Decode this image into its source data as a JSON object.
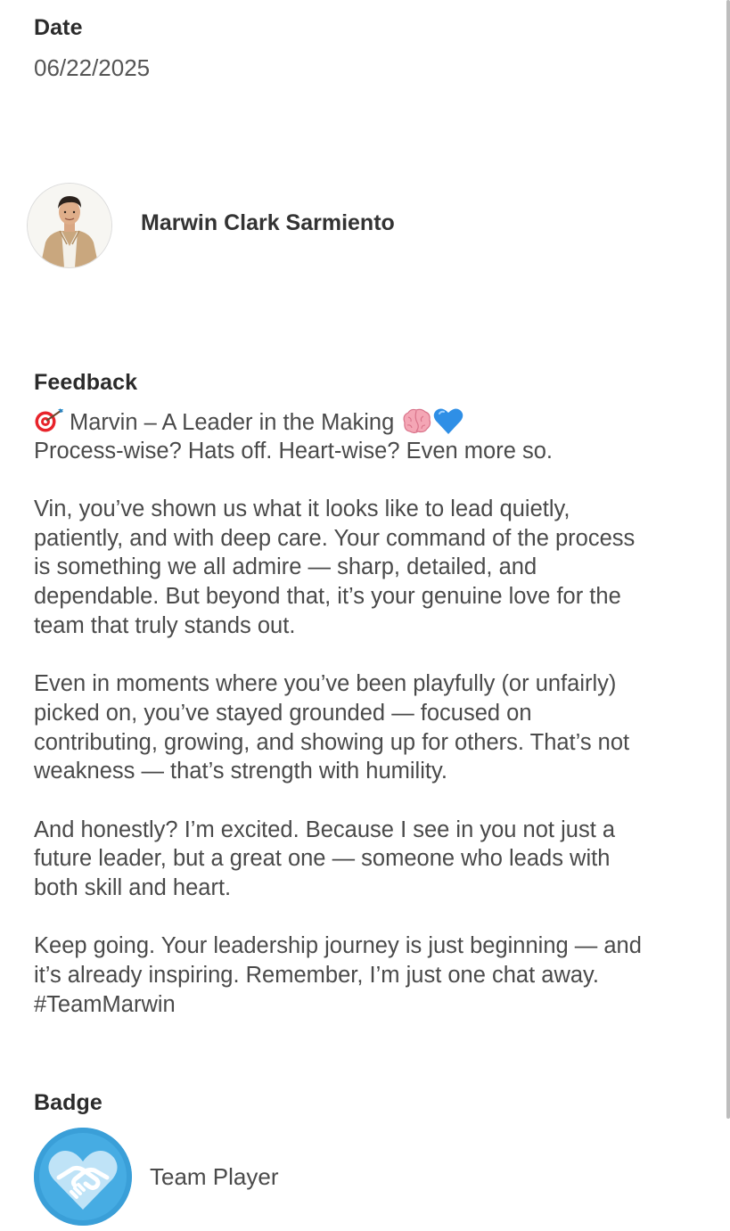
{
  "date": {
    "label": "Date",
    "value": "06/22/2025"
  },
  "recipient": {
    "name": "Marwin Clark Sarmiento",
    "avatar_icon": "person-photo"
  },
  "feedback": {
    "label": "Feedback",
    "headline_icon": "direct-hit-emoji",
    "headline": "Marvin – A Leader in the Making",
    "headline_emojis": [
      "brain-emoji",
      "blue-heart-emoji"
    ],
    "paragraphs": [
      [
        "Process-wise? Hats off. Heart-wise? Even more so."
      ],
      [
        "Vin, you’ve shown us what it looks like to lead quietly,",
        "patiently, and with deep care. Your command of the process",
        "is something we all admire — sharp, detailed, and",
        "dependable. But beyond that, it’s your genuine love for the",
        "team that truly stands out."
      ],
      [
        "Even in moments where you’ve been playfully (or unfairly)",
        "picked on, you’ve stayed grounded — focused on",
        "contributing, growing, and showing up for others. That’s not",
        "weakness — that’s strength with humility."
      ],
      [
        "And honestly? I’m excited. Because I see in you not just a",
        "future leader, but a great one — someone who leads with",
        "both skill and heart."
      ],
      [
        "Keep going. Your leadership journey is just beginning — and",
        "it’s already inspiring. Remember, I’m just one chat away.",
        "#TeamMarwin"
      ]
    ]
  },
  "badge": {
    "label": "Badge",
    "name": "Team Player",
    "icon": "handshake-heart-icon",
    "color": "#3a9fd8"
  },
  "colors": {
    "label_text": "#2b2b2b",
    "body_text": "#4a4a4a",
    "scrollbar": "#bdbdbd"
  }
}
